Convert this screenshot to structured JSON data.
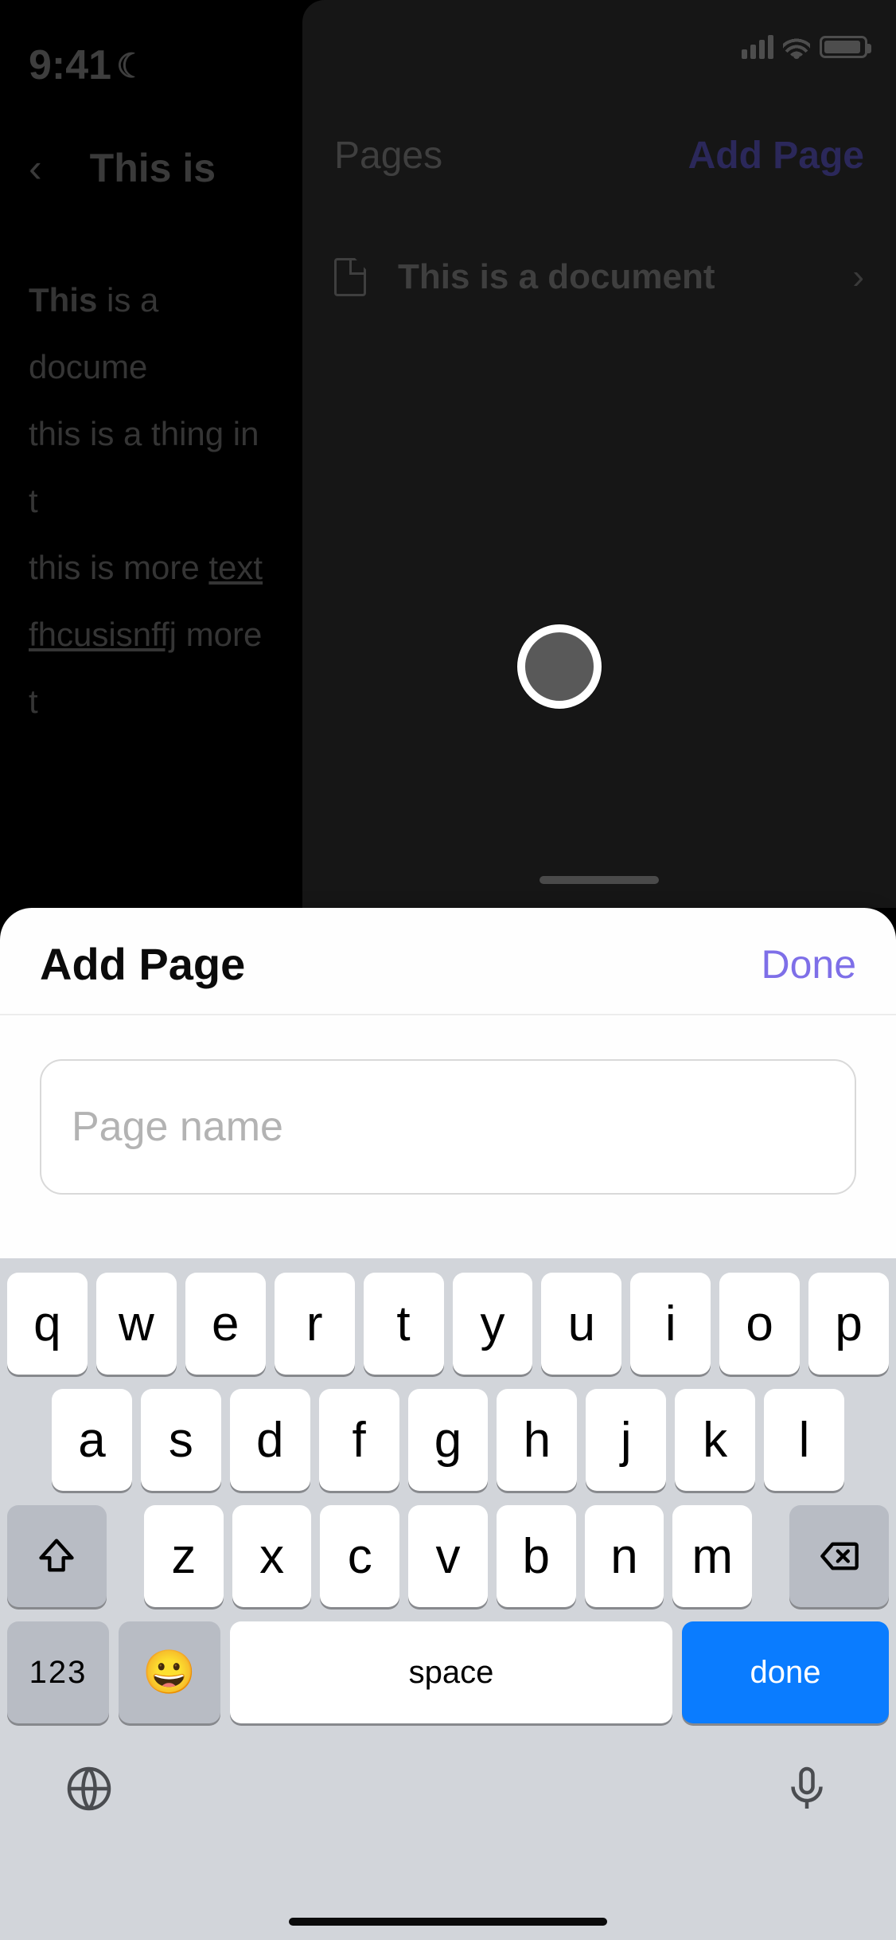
{
  "status_bar": {
    "time": "9:41"
  },
  "background_document": {
    "title": "This is",
    "line1_bold": "This",
    "line1_rest": " is a docume",
    "line2": "this is a thing in t",
    "line3_pre": "this is more ",
    "line3_link": "text ",
    "line4_link": "fhcusisnffj",
    "line4_rest": " more t"
  },
  "pages_panel": {
    "header_label": "Pages",
    "add_page_label": "Add Page",
    "items": [
      {
        "title": "This is a document"
      }
    ]
  },
  "add_page_modal": {
    "title": "Add Page",
    "done_label": "Done",
    "input_value": "",
    "input_placeholder": "Page name"
  },
  "keyboard": {
    "rows": {
      "r1": [
        "q",
        "w",
        "e",
        "r",
        "t",
        "y",
        "u",
        "i",
        "o",
        "p"
      ],
      "r2": [
        "a",
        "s",
        "d",
        "f",
        "g",
        "h",
        "j",
        "k",
        "l"
      ],
      "r3": [
        "z",
        "x",
        "c",
        "v",
        "b",
        "n",
        "m"
      ]
    },
    "numeric_label": "123",
    "space_label": "space",
    "enter_label": "done"
  }
}
